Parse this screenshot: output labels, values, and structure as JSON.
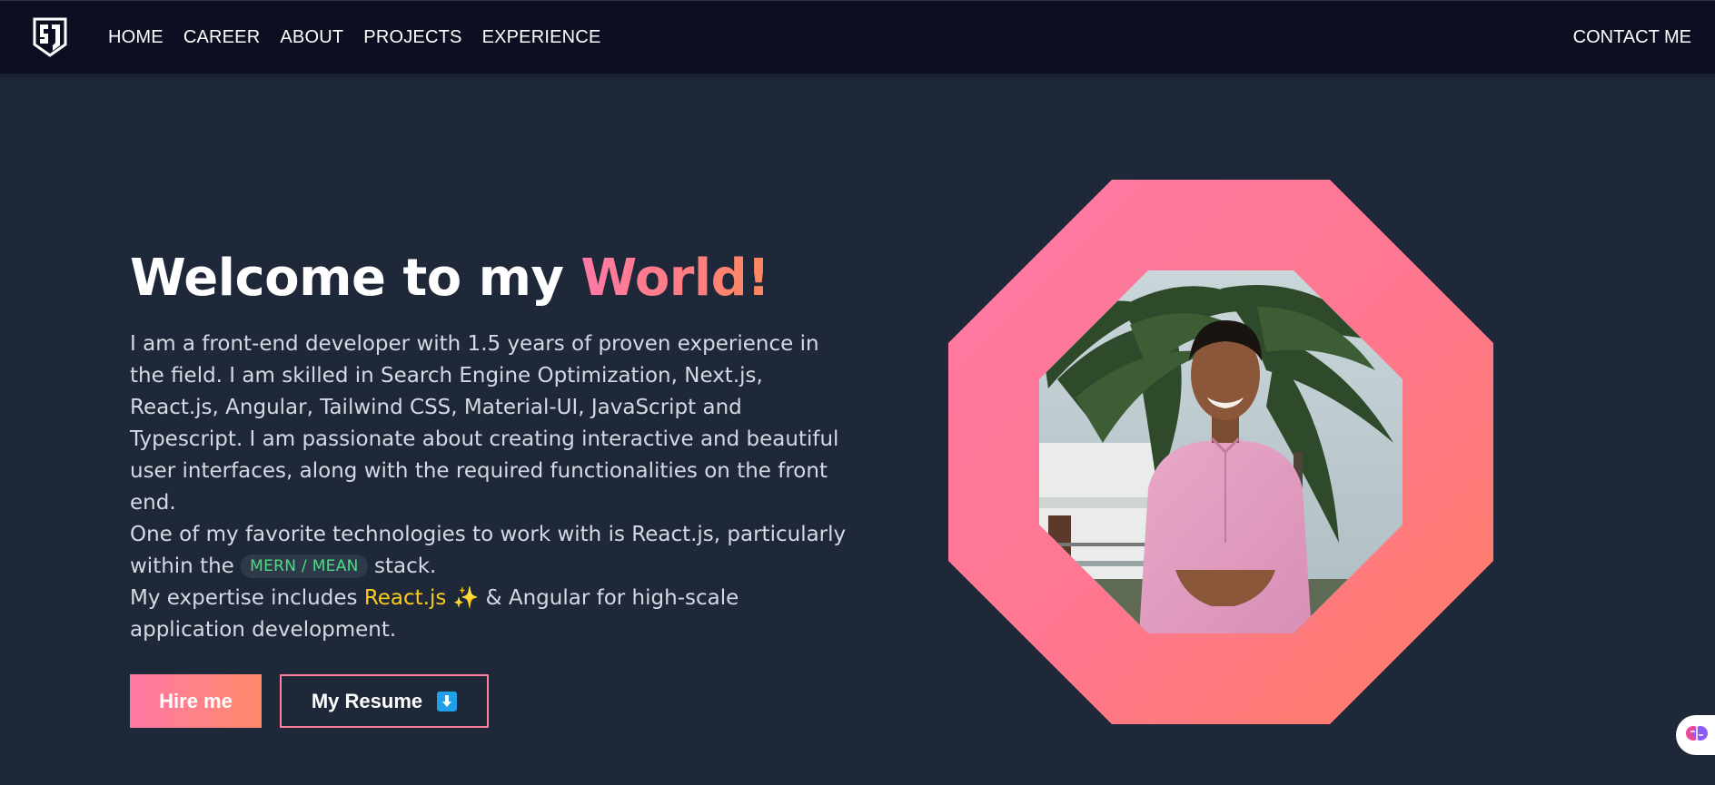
{
  "nav": {
    "logo_alt": "SJ logo",
    "links": [
      "HOME",
      "CAREER",
      "ABOUT",
      "PROJECTS",
      "EXPERIENCE"
    ],
    "contact": "CONTACT ME"
  },
  "hero": {
    "title_start": "Welcome to my ",
    "title_accent": "World!",
    "bio_1": "I am a front-end developer with 1.5 years of proven experience in the field. I am skilled in Search Engine Optimization, Next.js, React.js, Angular, Tailwind CSS, Material-UI, JavaScript and Typescript. I am passionate about creating interactive and beautiful user interfaces, along with the required functionalities on the front end.",
    "bio_2_start": "One of my favorite technologies to work with is React.js, particularly within the ",
    "stack_pill": "MERN / MEAN",
    "bio_2_end": " stack.",
    "bio_3_start": "My expertise includes ",
    "bio_3_highlight": "React.js",
    "bio_3_emoji": "✨",
    "bio_3_end": " & Angular for high-scale application development."
  },
  "buttons": {
    "hire": "Hire me",
    "resume": "My Resume",
    "resume_icon": "download-arrow-icon"
  },
  "colors": {
    "page_bg": "#1f2839",
    "nav_bg": "#0c0f21",
    "accent_pink": "#ff79a6",
    "accent_orange": "#ff8a5c",
    "pill_green": "#4ade80",
    "highlight_yellow": "#facc15"
  },
  "floating": {
    "icon": "brain-icon"
  }
}
